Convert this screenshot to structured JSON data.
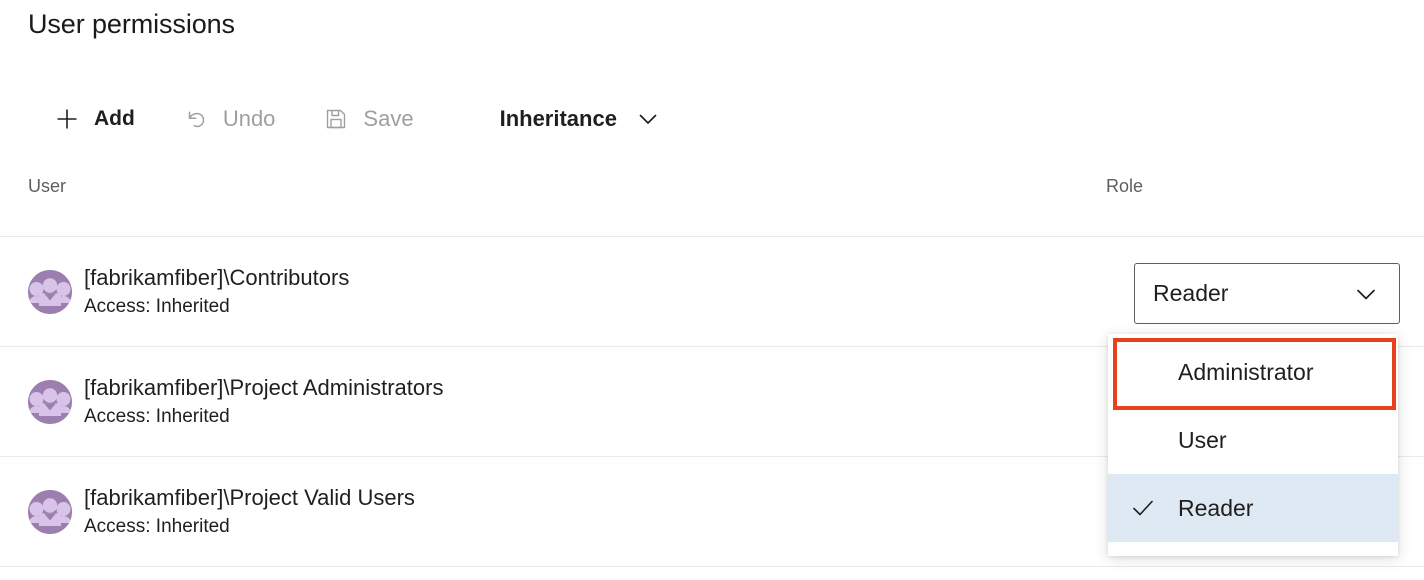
{
  "page": {
    "title": "User permissions"
  },
  "toolbar": {
    "items": [
      {
        "label": "Add",
        "icon": "plus-icon",
        "disabled": false
      },
      {
        "label": "Undo",
        "icon": "undo-icon",
        "disabled": true
      },
      {
        "label": "Save",
        "icon": "save-icon",
        "disabled": true
      },
      {
        "label": "Inheritance",
        "icon": "chevron-down-icon",
        "disabled": false
      }
    ]
  },
  "table": {
    "columns": [
      {
        "key": "user",
        "label": "User"
      },
      {
        "key": "role",
        "label": "Role"
      }
    ],
    "rows": [
      {
        "avatar": "group-avatar-icon",
        "name": "[fabrikamfiber]\\Contributors",
        "access": "Access: Inherited",
        "role": "Reader"
      },
      {
        "avatar": "group-avatar-icon",
        "name": "[fabrikamfiber]\\Project Administrators",
        "access": "Access: Inherited",
        "role": ""
      },
      {
        "avatar": "group-avatar-icon",
        "name": "[fabrikamfiber]\\Project Valid Users",
        "access": "Access: Inherited",
        "role": ""
      }
    ]
  },
  "role_combobox": {
    "value": "Reader",
    "caret_icon": "chevron-down-icon",
    "expanded": true,
    "options": [
      {
        "label": "Administrator",
        "selected": false,
        "highlighted": true
      },
      {
        "label": "User",
        "selected": false,
        "highlighted": false
      },
      {
        "label": "Reader",
        "selected": true,
        "highlighted": false
      }
    ],
    "check_icon": "checkmark-icon"
  },
  "colors": {
    "annotation": "#e8401f",
    "selected_option_bg": "#dfe9f4",
    "avatar_bg": "#9c7fae",
    "avatar_fg": "#d9c4e9",
    "disabled_text": "#a19f9d",
    "header_text": "#605e5c",
    "rule": "#edebe9"
  }
}
